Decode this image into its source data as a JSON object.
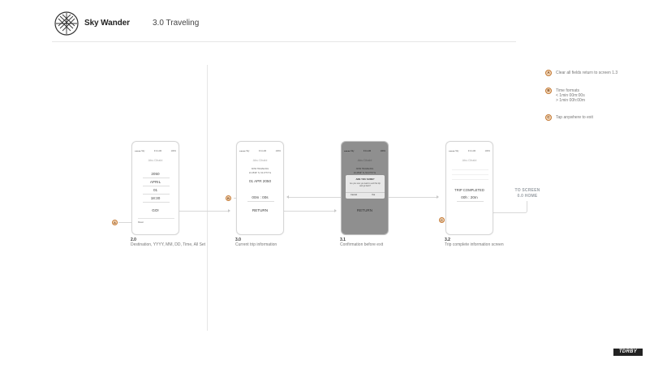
{
  "header": {
    "brand": "Sky Wander",
    "section": "3.0 Traveling"
  },
  "legend": [
    {
      "badge": "A",
      "lines": [
        "Clear all fields return to screen 1.3"
      ]
    },
    {
      "badge": "B",
      "lines": [
        "Time formats",
        "< 1min 00m:00s",
        "> 1min 00h:00m"
      ]
    },
    {
      "badge": "C",
      "lines": [
        "Tap anywhere to exit"
      ]
    }
  ],
  "screens": {
    "s20": {
      "destination": "Abu Dhabi",
      "year": "2050",
      "month": "APRIL",
      "day": "01",
      "time": "18:30",
      "go_label": "GO!",
      "reset_label": "Reset",
      "number": "2.0",
      "caption": "Destination, YYYY, MM, DD, Time, All Set"
    },
    "s30": {
      "destination": "Abu Dhabi",
      "status": "NOW TRAVELING",
      "coords": "24.4539° N, 54.3773° E",
      "date": "01 APR 2050",
      "timer": "00m : 00s",
      "return_label": "RETURN",
      "number": "3.0",
      "caption": "Current trip information"
    },
    "s31": {
      "destination": "Abu Dhabi",
      "status": "NOW TRAVELING",
      "coords": "24.4539° N, 54.3773° E",
      "date": "01 APR 2050",
      "dialog_title": "ARE YOU SURE?",
      "dialog_body": "Are you sure you want to end this trip and go back?",
      "cancel_label": "Cancel",
      "yes_label": "Yes",
      "return_label": "RETURN",
      "number": "3.1",
      "caption": "Confirmation before exit"
    },
    "s32": {
      "destination": "Abu Dhabi",
      "completed": "TRIP COMPLETED",
      "duration": "00h : 20m",
      "number": "3.2",
      "caption": "Trip complete information screen"
    }
  },
  "callouts": {
    "a": "A",
    "b": "B",
    "c": "C"
  },
  "to_screen": {
    "line1": "TO SCREEN",
    "line2": "0.0 HOME"
  },
  "watermark": "TDRBY",
  "colors": {
    "badge_fill": "#f3d7b8",
    "badge_border": "#c47a36",
    "dim_overlay": "#8f8f8f"
  }
}
